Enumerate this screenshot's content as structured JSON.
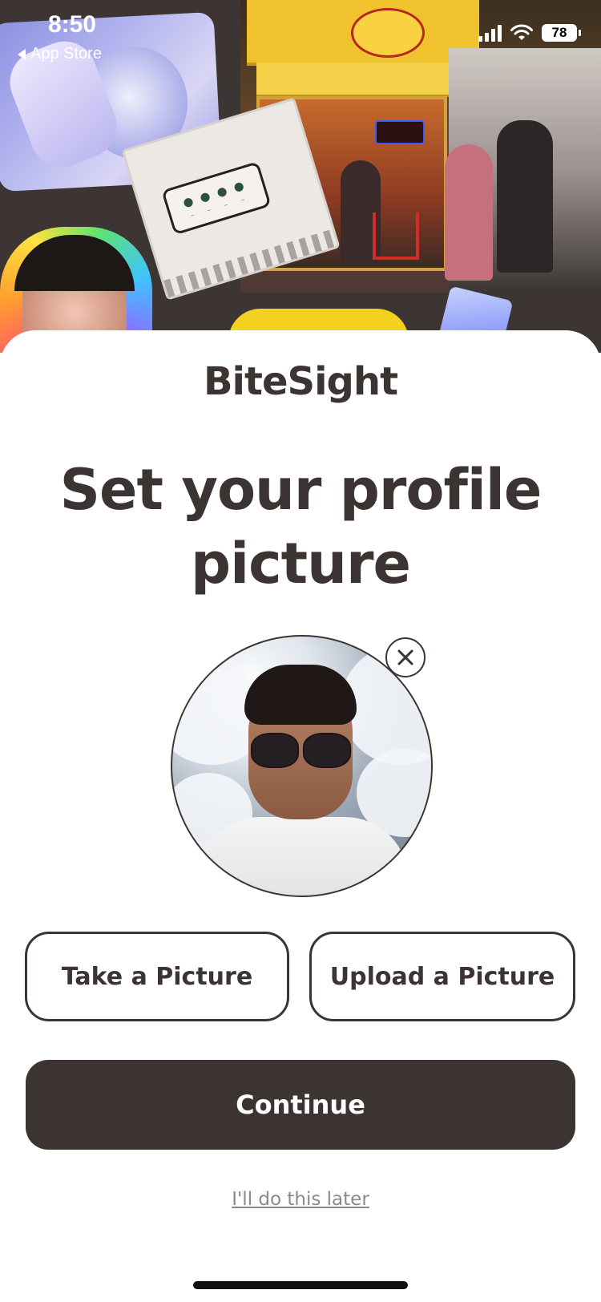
{
  "status_bar": {
    "time": "8:50",
    "back_label": "App Store",
    "battery": "78"
  },
  "brand": {
    "name": "BiteSight"
  },
  "header": {
    "title": "Set your profile picture"
  },
  "profile": {
    "remove_icon": "close-icon"
  },
  "actions": {
    "take_picture": "Take a Picture",
    "upload_picture": "Upload a Picture",
    "continue": "Continue",
    "skip": "I'll do this later"
  },
  "colors": {
    "brand_dark": "#3b3433",
    "background": "#ffffff",
    "link_gray": "#8e8887"
  }
}
